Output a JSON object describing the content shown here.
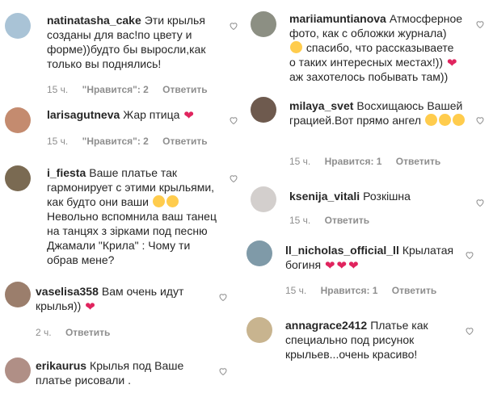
{
  "left": [
    {
      "user": "natinatasha_cake",
      "text": "Эти крылья созданы для вас!по цвету и форме))будто бы выросли,как только вы поднялись!",
      "time": "15 ч.",
      "likes": "\"Нравится\": 2",
      "reply": "Ответить",
      "avatar_color": "#a9c3d6"
    },
    {
      "user": "larisagutneva",
      "text": "Жар птица",
      "emoji": "❤",
      "time": "15 ч.",
      "likes": "\"Нравится\": 2",
      "reply": "Ответить",
      "avatar_color": "#c48b6f"
    },
    {
      "user": "i_fiesta",
      "text": "Ваше платье так гармонирует с этими крыльями, как будто они ваши",
      "text2": "Невольно вспомнила ваш танец на танцях з зірками под песню Джамали \"Крила\" : Чому ти обрав мене?",
      "avatar_color": "#7a6a52"
    },
    {
      "user": "vaselisa358",
      "text": "Вам очень идут крылья))",
      "emoji": "❤",
      "time": "2 ч.",
      "reply": "Ответить",
      "avatar_color": "#9b7e6c"
    },
    {
      "user": "erikaurus",
      "text": "Крылья под Ваше платье рисовали .",
      "avatar_color": "#b08f86"
    }
  ],
  "right": [
    {
      "user": "mariiamuntianova",
      "text": "Атмосферное фото, как с обложки журнала)",
      "text2": "спасибо, что рассказываете о таких интересных местах!))",
      "text3": "аж захотелось побывать там))",
      "emoji": "❤",
      "avatar_color": "#8c8f83"
    },
    {
      "user": "milaya_svet",
      "text": "Восхищаюсь Вашей грацией.Вот прямо ангел",
      "time": "15 ч.",
      "likes": "Нравится: 1",
      "reply": "Ответить",
      "avatar_color": "#6e5a4e"
    },
    {
      "user": "ksenija_vitali",
      "text": "Розкішна",
      "time": "15 ч.",
      "reply": "Ответить",
      "avatar_color": "#d3cfcd"
    },
    {
      "user": "ll_nicholas_official_ll",
      "text": "Крылатая богиня",
      "emoji": "❤",
      "time": "15 ч.",
      "likes": "Нравится: 1",
      "reply": "Ответить",
      "avatar_color": "#7f9aa8"
    },
    {
      "user": "annagrace2412",
      "text": "Платье как специально под рисунок крыльев...очень красиво!",
      "avatar_color": "#c8b48f"
    }
  ]
}
